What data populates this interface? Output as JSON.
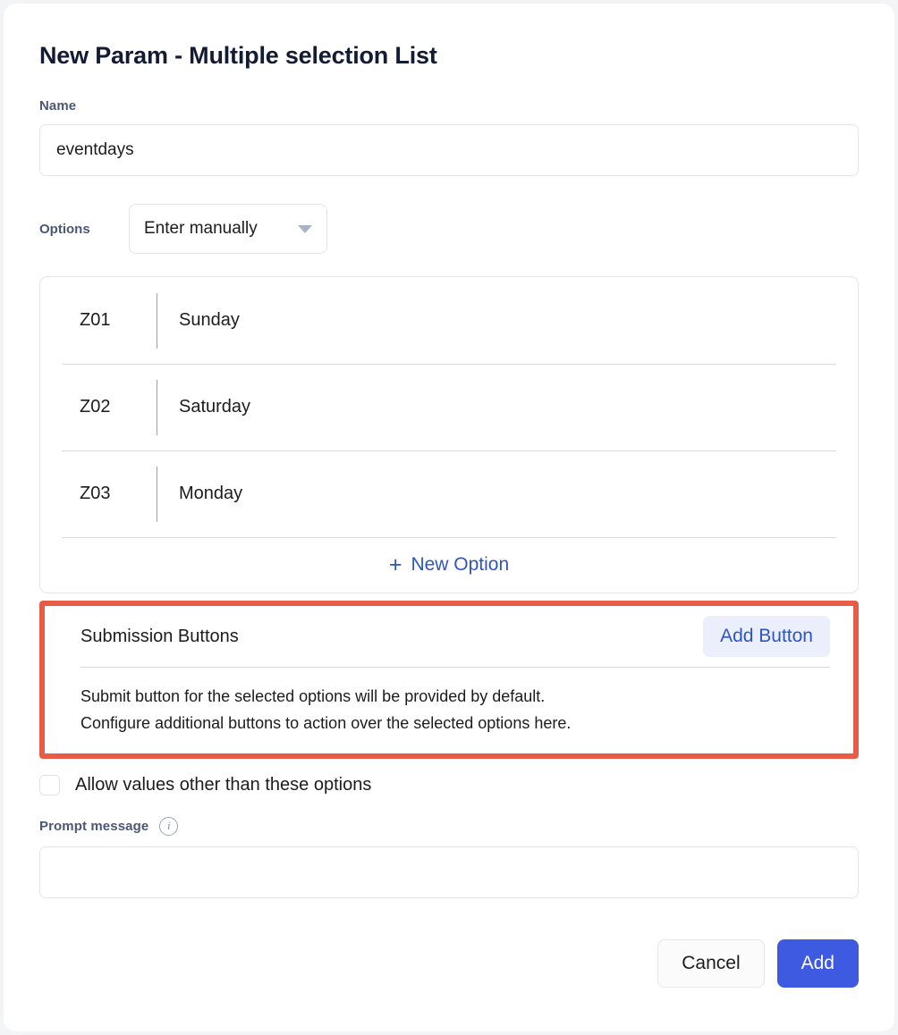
{
  "dialog": {
    "title": "New Param - Multiple selection List"
  },
  "name_field": {
    "label": "Name",
    "value": "eventdays",
    "placeholder": ""
  },
  "options_field": {
    "label": "Options",
    "selected": "Enter manually",
    "caret_icon": "chevron-down-icon"
  },
  "options_list": {
    "rows": [
      {
        "code": "Z01",
        "label": "Sunday"
      },
      {
        "code": "Z02",
        "label": "Saturday"
      },
      {
        "code": "Z03",
        "label": "Monday"
      }
    ],
    "new_option_label": "New Option",
    "new_option_plus": "+"
  },
  "submission_buttons": {
    "title": "Submission Buttons",
    "add_button_label": "Add Button",
    "description_line1": "Submit button for the selected options will be provided by default.",
    "description_line2": "Configure additional buttons to action over the selected options here.",
    "highlight_color": "#e85b47",
    "accent_color": "#2f55c4",
    "pill_background": "#eaeffb"
  },
  "allow_other": {
    "label": "Allow values other than these options",
    "checked": false
  },
  "prompt_message": {
    "label": "Prompt message",
    "info_icon": "info-circle-icon",
    "value": "",
    "placeholder": ""
  },
  "footer": {
    "cancel_label": "Cancel",
    "add_label": "Add",
    "add_color": "#3d5ae0"
  }
}
